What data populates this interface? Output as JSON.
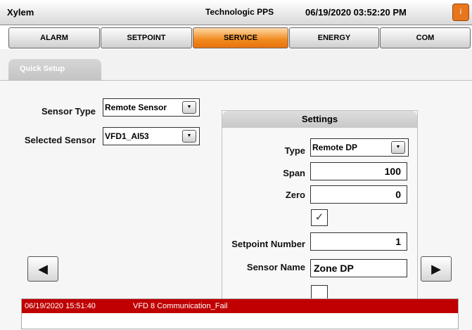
{
  "header": {
    "app_title": "Xylem",
    "center_title": "Technologic PPS",
    "datetime": "06/19/2020 03:52:20 PM",
    "info_icon": "info-icon",
    "info_glyph": "i"
  },
  "tabs": [
    {
      "label": "ALARM",
      "active": false
    },
    {
      "label": "SETPOINT",
      "active": false
    },
    {
      "label": "SERVICE",
      "active": true
    },
    {
      "label": "ENERGY",
      "active": false
    },
    {
      "label": "COM",
      "active": false
    }
  ],
  "subtab": {
    "label": "Quick Setup"
  },
  "left": {
    "sensor_type_label": "Sensor Type",
    "sensor_type_value": "Remote Sensor",
    "selected_sensor_label": "Selected Sensor",
    "selected_sensor_value": "VFD1_AI53"
  },
  "settings": {
    "header": "Settings",
    "type_label": "Type",
    "type_value": "Remote DP",
    "span_label": "Span",
    "span_value": "100",
    "zero_label": "Zero",
    "zero_value": "0",
    "check1_checked": true,
    "check1_glyph": "✓",
    "setpoint_number_label": "Setpoint Number",
    "setpoint_number_value": "1",
    "sensor_name_label": "Sensor Name",
    "sensor_name_value": "Zone DP",
    "check2_checked": false
  },
  "nav": {
    "prev_icon": "left-arrow-icon",
    "prev_glyph": "◀",
    "next_icon": "right-arrow-icon",
    "next_glyph": "▶"
  },
  "alarms": [
    {
      "time": "06/19/2020 15:51:40",
      "message": "VFD 8 Communication_Fail"
    }
  ],
  "colors": {
    "active_tab": "#e87410",
    "alarm_row": "#c00000",
    "info_button": "#e8761c"
  }
}
